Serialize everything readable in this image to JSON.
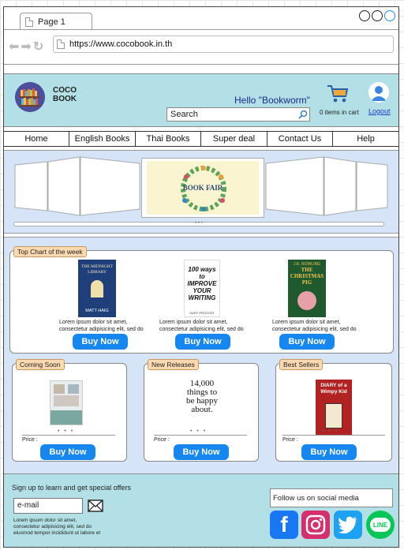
{
  "browser": {
    "tab_title": "Page 1",
    "url": "https://www.cocobook.in.th"
  },
  "header": {
    "brand_line1": "COCO",
    "brand_line2": "BOOK",
    "greeting": "Hello \"Bookworm\"",
    "search_placeholder": "Search",
    "cart_text": "0 items in cart",
    "logout_label": "Logout"
  },
  "nav": {
    "items": [
      "Home",
      "English Books",
      "Thai Books",
      "Super deal",
      "Contact Us",
      "Help"
    ]
  },
  "carousel": {
    "banner_title": "BOOK FAIR",
    "dots": "• • •"
  },
  "top_chart": {
    "label": "Top Chart of the week",
    "books": [
      {
        "cover_title": "THE MIDNIGHT LIBRARY",
        "cover_author": "MATT HAIG",
        "desc1": "Lorem ipsum dolor sit amet,",
        "desc2": "consectetur adipisicing elit, sed do",
        "button": "Buy Now"
      },
      {
        "cover_title": "100 ways to IMPROVE YOUR WRITING",
        "cover_author": "GARY PROVOST",
        "desc1": "Lorem ipsum dolor sit amet,",
        "desc2": "consectetur adipisicing elit, sed do",
        "button": "Buy Now"
      },
      {
        "cover_title": "THE CHRISTMAS PIG",
        "cover_author": "J.K. ROWLING",
        "desc1": "Lorem ipsum dolor sit amet,",
        "desc2": "consectetur adipisicing elit, sed do",
        "button": "Buy Now"
      }
    ]
  },
  "sections": [
    {
      "label": "Coming Soon",
      "dots": "• • •",
      "price_label": "Price :",
      "button": "Buy Now"
    },
    {
      "label": "New Releases",
      "cover_text": "14,000 things to be happy about.",
      "dots": "• • •",
      "price_label": "Price :",
      "button": "Buy Now"
    },
    {
      "label": "Best Sellers",
      "cover_title": "DIARY of a Wimpy Kid",
      "dots": "• • •",
      "price_label": "Price :",
      "button": "Buy Now"
    }
  ],
  "footer": {
    "signup_text": "Sign up to learn and get special offers",
    "email_placeholder": "e-mail",
    "lorem1": "Lorem ipsum dolor sit amet,",
    "lorem2": "consectetur adipisicing elit, sed do",
    "lorem3": "eiusmod tempor incididunt ut labore et",
    "follow_text": "Follow us on social media",
    "social": [
      {
        "icon": "facebook-icon",
        "color": "#1877f2"
      },
      {
        "icon": "instagram-icon",
        "color": "#e1306c"
      },
      {
        "icon": "twitter-icon",
        "color": "#1da1f2"
      },
      {
        "icon": "line-icon",
        "color": "#06c755",
        "text": "LINE"
      }
    ]
  },
  "colors": {
    "header_bg": "#b2e0e6",
    "section_bg": "#d6e4f7",
    "button": "#1687f0",
    "label_bg": "#fcd9b0"
  }
}
